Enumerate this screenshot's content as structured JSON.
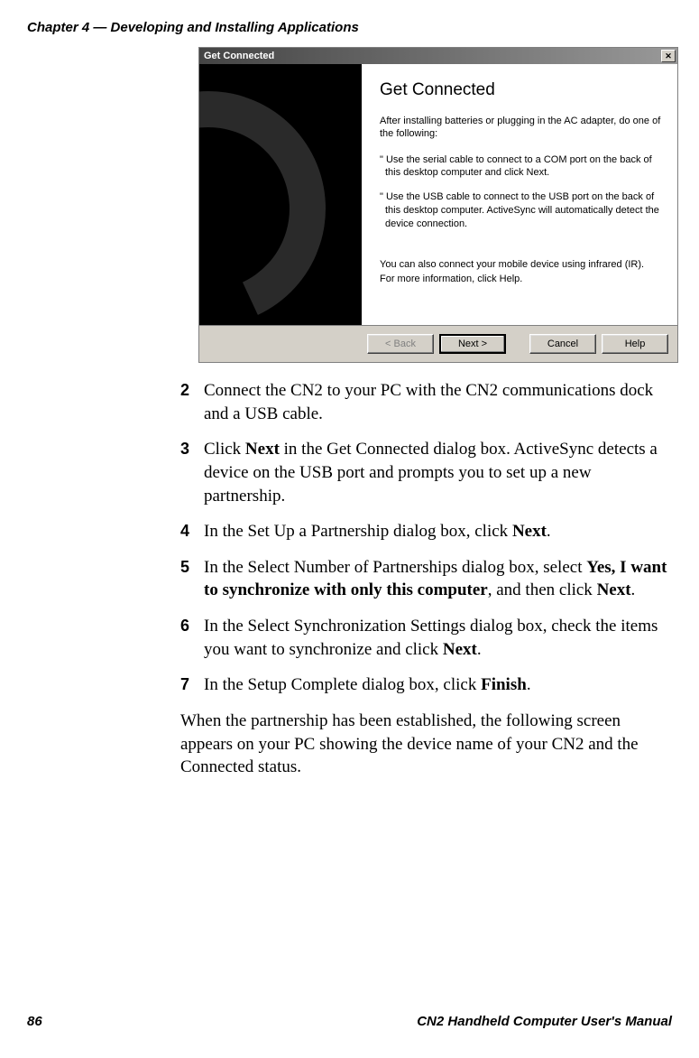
{
  "header": {
    "chapter": "Chapter 4 — Developing and Installing Applications"
  },
  "dialog": {
    "title": "Get Connected",
    "heading": "Get Connected",
    "intro": "After installing batteries or plugging in the AC adapter, do one of the following:",
    "bullet1": "Use the serial cable to connect to a COM port on the back of this desktop computer and click Next.",
    "bullet2": "Use the USB cable to connect to the USB port on the back of this desktop computer.   ActiveSync will automatically detect the device connection.",
    "note1": "You can also connect your mobile device using infrared (IR).",
    "note2": "For more information, click Help.",
    "buttons": {
      "back": "< Back",
      "next": "Next >",
      "cancel": "Cancel",
      "help": "Help"
    }
  },
  "steps": {
    "s2": {
      "num": "2",
      "text_a": "Connect the CN2 to your PC with the CN2 communications dock and a USB cable."
    },
    "s3": {
      "num": "3",
      "text_a": "Click ",
      "bold1": "Next",
      "text_b": " in the Get Connected dialog box. ActiveSync detects a device on the USB port and prompts you to set up a new partnership."
    },
    "s4": {
      "num": "4",
      "text_a": "In the Set Up a Partnership dialog box, click ",
      "bold1": "Next",
      "text_b": "."
    },
    "s5": {
      "num": "5",
      "text_a": "In the Select Number of Partnerships dialog box, select ",
      "bold1": "Yes, I want to synchronize with only this computer",
      "text_b": ", and then click ",
      "bold2": "Next",
      "text_c": "."
    },
    "s6": {
      "num": "6",
      "text_a": "In the Select Synchronization Settings dialog box, check the items you want to synchronize and click ",
      "bold1": "Next",
      "text_b": "."
    },
    "s7": {
      "num": "7",
      "text_a": "In the Setup Complete dialog box, click ",
      "bold1": "Finish",
      "text_b": "."
    },
    "closing": "When the partnership has been established, the following screen appears on your PC showing the device name of your CN2 and the Connected status."
  },
  "footer": {
    "page": "86",
    "manual": "CN2 Handheld Computer User's Manual"
  }
}
